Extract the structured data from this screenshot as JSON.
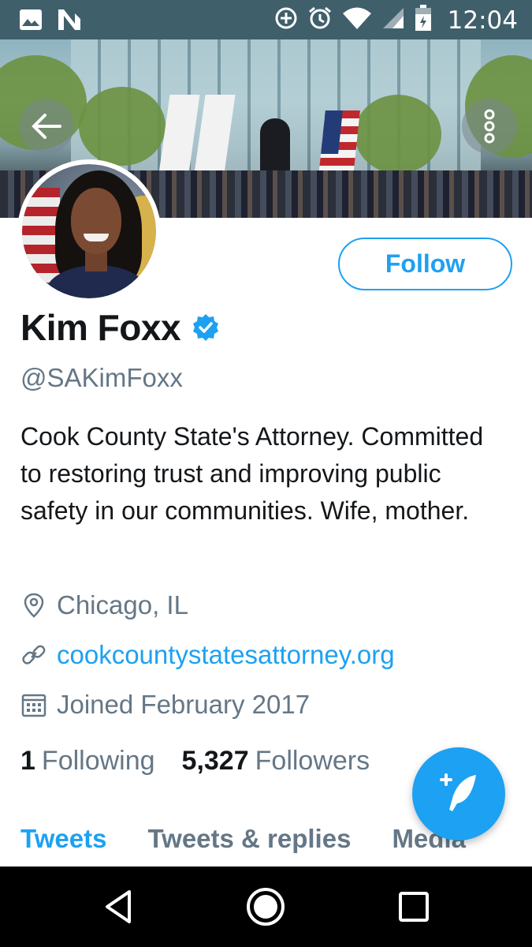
{
  "status_bar": {
    "time": "12:04",
    "icons": [
      "image-icon",
      "n-icon",
      "data-saver-icon",
      "alarm-icon",
      "wifi-icon",
      "signal-icon",
      "battery-icon"
    ]
  },
  "banner": {
    "back_icon": "arrow-left-icon",
    "more_icon": "more-vertical-icon"
  },
  "profile": {
    "follow_label": "Follow",
    "name": "Kim Foxx",
    "verified_icon": "verified-badge-icon",
    "handle": "@SAKimFoxx",
    "bio": "Cook County State's Attorney. Committed to restoring trust and improving public safety in our communities. Wife, mother.",
    "location": "Chicago, IL",
    "website": "cookcountystatesattorney.org",
    "joined": "Joined February 2017",
    "following_count": "1",
    "following_label": "Following",
    "followers_count": "5,327",
    "followers_label": "Followers"
  },
  "tabs": [
    {
      "label": "Tweets",
      "active": true
    },
    {
      "label": "Tweets & replies",
      "active": false
    },
    {
      "label": "Media",
      "active": false
    }
  ],
  "fab": {
    "icon": "compose-tweet-icon"
  },
  "nav_bar": {
    "icons": [
      "back-triangle-icon",
      "home-circle-icon",
      "recents-square-icon"
    ]
  },
  "colors": {
    "accent": "#1da1f2",
    "status_bar": "#3f5f6b",
    "secondary_text": "#657786"
  }
}
